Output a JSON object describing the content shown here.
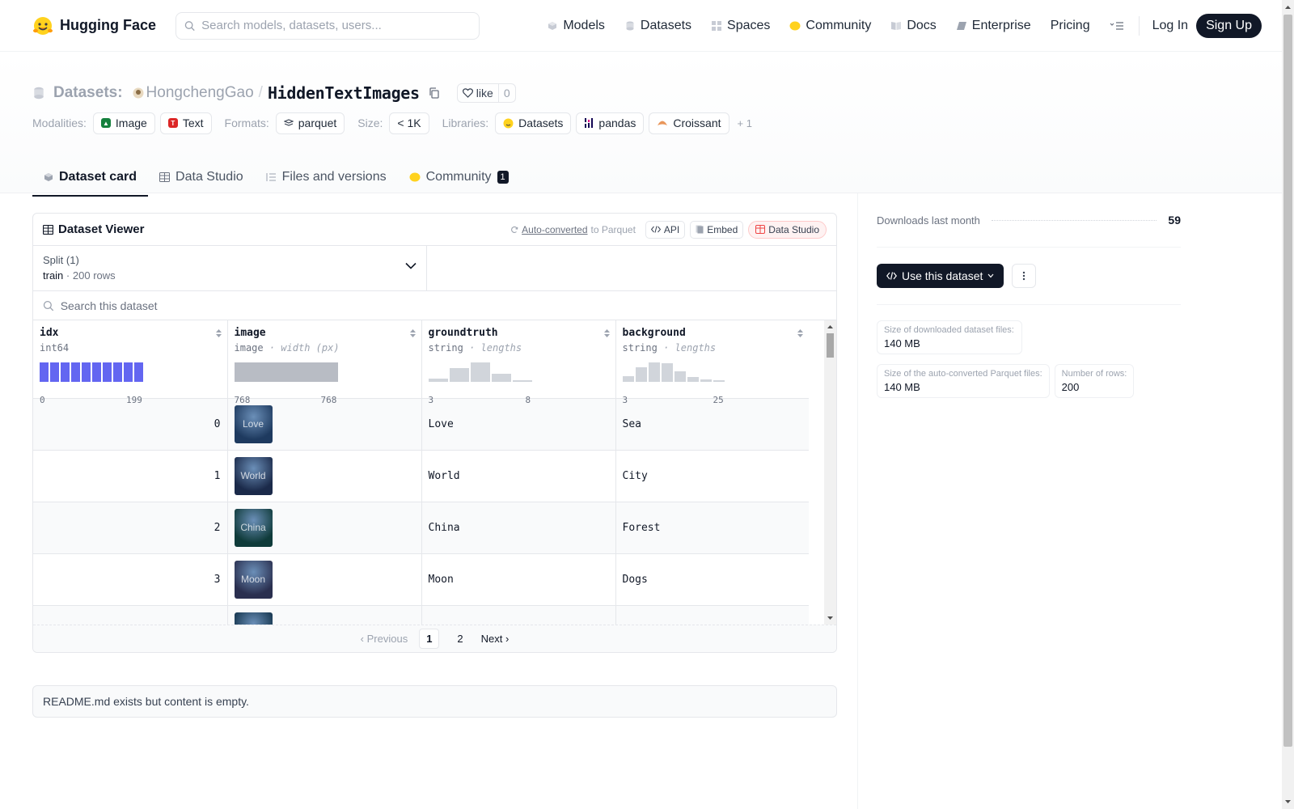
{
  "nav": {
    "brand": "Hugging Face",
    "search_placeholder": "Search models, datasets, users...",
    "links": [
      "Models",
      "Datasets",
      "Spaces",
      "Community",
      "Docs",
      "Enterprise",
      "Pricing"
    ],
    "login": "Log In",
    "signup": "Sign Up"
  },
  "header": {
    "section": "Datasets:",
    "user": "HongchengGao",
    "sep": "/",
    "repo": "HiddenTextImages",
    "like_label": "like",
    "like_count": "0",
    "modalities_label": "Modalities:",
    "modalities": [
      "Image",
      "Text"
    ],
    "formats_label": "Formats:",
    "formats": [
      "parquet"
    ],
    "size_label": "Size:",
    "size": "< 1K",
    "libraries_label": "Libraries:",
    "libraries": [
      "Datasets",
      "pandas",
      "Croissant"
    ],
    "more": "+ 1"
  },
  "tabs": [
    {
      "label": "Dataset card"
    },
    {
      "label": "Data Studio"
    },
    {
      "label": "Files and versions"
    },
    {
      "label": "Community",
      "badge": "1"
    }
  ],
  "viewer": {
    "title": "Dataset Viewer",
    "auto_converted": "Auto-converted",
    "to_parquet": "to Parquet",
    "api": "API",
    "embed": "Embed",
    "data_studio": "Data Studio",
    "split_label": "Split (1)",
    "split_name": "train",
    "split_dot": "·",
    "split_rows": "200 rows",
    "search_placeholder": "Search this dataset",
    "columns": [
      {
        "name": "idx",
        "type": "int64",
        "sub": "",
        "min": "0",
        "max": "199"
      },
      {
        "name": "image",
        "type": "image",
        "sub": "· width (px)",
        "min": "768",
        "max": "768"
      },
      {
        "name": "groundtruth",
        "type": "string",
        "sub": "· lengths",
        "min": "3",
        "max": "8"
      },
      {
        "name": "background",
        "type": "string",
        "sub": "· lengths",
        "min": "3",
        "max": "25"
      }
    ],
    "hist_groundtruth": [
      0.15,
      0.7,
      1.0,
      0.4,
      0.05
    ],
    "hist_background": [
      0.3,
      0.75,
      1.0,
      0.95,
      0.55,
      0.25,
      0.12,
      0.05
    ],
    "rows": [
      {
        "idx": "0",
        "img_text": "Love",
        "groundtruth": "Love",
        "background": "Sea",
        "img_color": "#1e3a5f"
      },
      {
        "idx": "1",
        "img_text": "World",
        "groundtruth": "World",
        "background": "City",
        "img_color": "#1b2a4a"
      },
      {
        "idx": "2",
        "img_text": "China",
        "groundtruth": "China",
        "background": "Forest",
        "img_color": "#0f3b3a"
      },
      {
        "idx": "3",
        "img_text": "Moon",
        "groundtruth": "Moon",
        "background": "Dogs",
        "img_color": "#2a2f4f"
      },
      {
        "idx": "",
        "img_text": "",
        "groundtruth": "",
        "background": "",
        "img_color": "#12324a"
      }
    ],
    "pager": {
      "prev": "Previous",
      "pages": [
        "1",
        "2"
      ],
      "next": "Next"
    }
  },
  "readme": "README.md exists but content is empty.",
  "sidebar": {
    "downloads_label": "Downloads last month",
    "downloads_value": "59",
    "use_button": "Use this dataset",
    "stats": [
      {
        "label": "Size of downloaded dataset files:",
        "value": "140 MB"
      },
      {
        "label": "Size of the auto-converted Parquet files:",
        "value": "140 MB"
      },
      {
        "label": "Number of rows:",
        "value": "200"
      }
    ]
  }
}
